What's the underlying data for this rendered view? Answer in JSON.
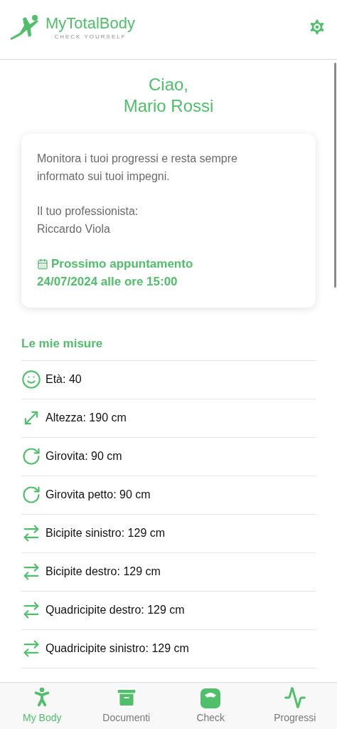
{
  "header": {
    "logo_text": "MyTotalBody",
    "logo_tagline": "CHECK YOURSELF"
  },
  "greeting": {
    "line_1": "Ciao,",
    "line_2": "Mario Rossi"
  },
  "card": {
    "intro": "Monitora i tuoi progressi e resta sempre informato sui tuoi impegni.",
    "professional_label": "Il tuo professionista:",
    "professional_name": "Riccardo Viola",
    "appointment_title": "Prossimo appuntamento",
    "appointment_time": "24/07/2024 alle ore 15:00"
  },
  "measures": {
    "title": "Le mie misure",
    "items": [
      {
        "kind": "age",
        "label": "Età: 40"
      },
      {
        "kind": "height",
        "label": "Altezza: 190 cm"
      },
      {
        "kind": "circumference",
        "label": "Girovita: 90 cm"
      },
      {
        "kind": "circumference",
        "label": "Girovita petto: 90 cm"
      },
      {
        "kind": "limb",
        "label": "Bicipite sinistro: 129 cm"
      },
      {
        "kind": "limb",
        "label": "Bicipite destro: 129 cm"
      },
      {
        "kind": "limb",
        "label": "Quadricipite destro: 129 cm"
      },
      {
        "kind": "limb",
        "label": "Quadricipite sinistro: 129 cm"
      }
    ]
  },
  "tab_bar": [
    {
      "kind": "body",
      "label": "My Body",
      "selected": true
    },
    {
      "kind": "documents",
      "label": "Documenti",
      "selected": false
    },
    {
      "kind": "check",
      "label": "Check",
      "selected": false
    },
    {
      "kind": "progress",
      "label": "Progressi",
      "selected": false
    }
  ]
}
